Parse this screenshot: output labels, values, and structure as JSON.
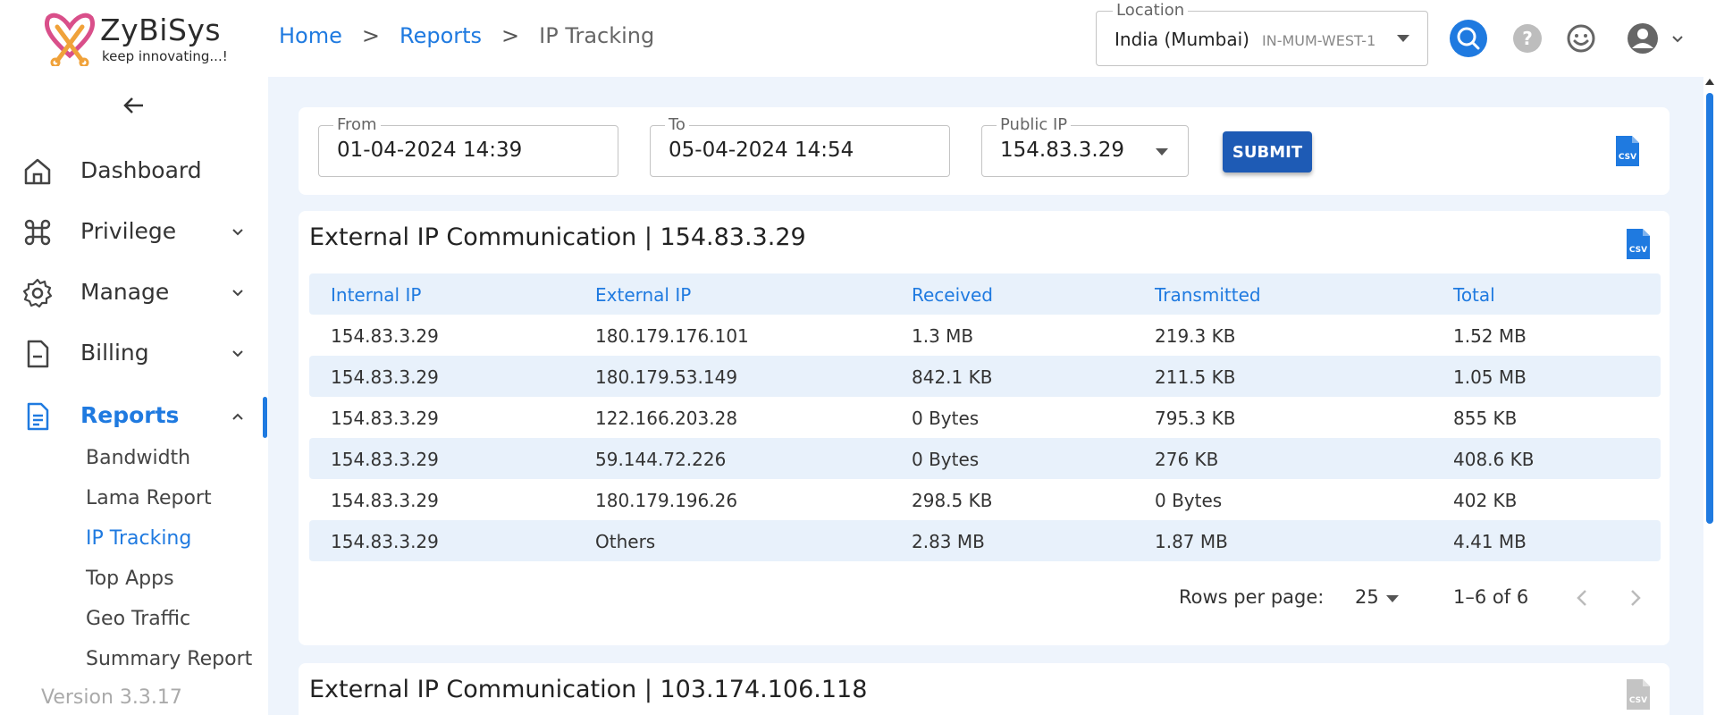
{
  "header": {
    "logo_name": "ZyBiSys",
    "logo_tagline": "keep innovating...!",
    "breadcrumb": [
      "Home",
      "Reports",
      "IP Tracking"
    ],
    "breadcrumb_sep": ">",
    "location": {
      "legend": "Location",
      "value": "India (Mumbai)",
      "code": "IN-MUM-WEST-1"
    },
    "icons": [
      "search-icon",
      "help-icon",
      "smile-icon",
      "user-icon",
      "chevron-down-icon"
    ],
    "accent": "#1f7ae0"
  },
  "sidebar": {
    "items": [
      {
        "label": "Dashboard",
        "icon": "home-icon"
      },
      {
        "label": "Privilege",
        "icon": "command-icon"
      },
      {
        "label": "Manage",
        "icon": "gear-icon"
      },
      {
        "label": "Billing",
        "icon": "document-minus-icon"
      },
      {
        "label": "Reports",
        "icon": "report-icon"
      }
    ],
    "sub_items": [
      "Bandwidth",
      "Lama Report",
      "IP Tracking",
      "Top Apps",
      "Geo Traffic",
      "Summary Report"
    ],
    "active_sub": "IP Tracking",
    "version": "Version 3.3.17"
  },
  "filters": {
    "from_label": "From",
    "from_value": "01-04-2024 14:39",
    "to_label": "To",
    "to_value": "05-04-2024 14:54",
    "ip_label": "Public IP",
    "ip_value": "154.83.3.29",
    "submit_label": "SUBMIT",
    "csv_label": "CSV"
  },
  "table1": {
    "title": "External IP Communication | 154.83.3.29",
    "columns": [
      "Internal IP",
      "External IP",
      "Received",
      "Transmitted",
      "Total"
    ],
    "rows": [
      [
        "154.83.3.29",
        "180.179.176.101",
        "1.3 MB",
        "219.3 KB",
        "1.52 MB"
      ],
      [
        "154.83.3.29",
        "180.179.53.149",
        "842.1 KB",
        "211.5 KB",
        "1.05 MB"
      ],
      [
        "154.83.3.29",
        "122.166.203.28",
        "0 Bytes",
        "795.3 KB",
        "855 KB"
      ],
      [
        "154.83.3.29",
        "59.144.72.226",
        "0 Bytes",
        "276 KB",
        "408.6 KB"
      ],
      [
        "154.83.3.29",
        "180.179.196.26",
        "298.5 KB",
        "0 Bytes",
        "402 KB"
      ],
      [
        "154.83.3.29",
        "Others",
        "2.83 MB",
        "1.87 MB",
        "4.41 MB"
      ]
    ],
    "rows_per_page_label": "Rows per page:",
    "rows_per_page": "25",
    "range": "1–6 of 6"
  },
  "table2": {
    "title": "External IP Communication | 103.174.106.118"
  }
}
